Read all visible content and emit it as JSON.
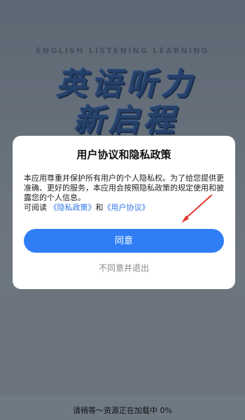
{
  "splash": {
    "subtitle": "ENGLISH LISTENING LEARNING",
    "title_line1": "英语听力",
    "title_line2": "新启程"
  },
  "dialog": {
    "title": "用户协议和隐私政策",
    "body_line1": "本应用尊重并保护所有用户的个人隐私权。为了给您提供更准确、更好的服务，本应用会按照隐私政策的规定使用和披露您的个人信息。",
    "read_prefix": "可阅读",
    "privacy_link": "《隐私政策》",
    "and_text": "和",
    "user_agreement_link": "《用户协议》",
    "agree_label": "同意",
    "disagree_label": "不同意并退出"
  },
  "footer": {
    "loading_text": "请稍等～资源正在加载中 0%"
  },
  "colors": {
    "accent": "#2f7ef6",
    "link": "#2f74e6",
    "annotation_arrow": "#e03a2f"
  },
  "icons": {
    "annotation": "red-arrow-icon"
  }
}
